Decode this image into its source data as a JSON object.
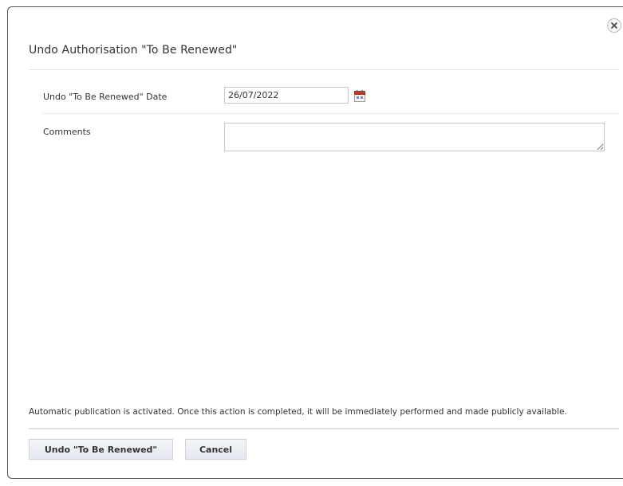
{
  "dialog": {
    "title": "Undo Authorisation \"To Be Renewed\"",
    "close_icon": "close-icon"
  },
  "form": {
    "date_label": "Undo \"To Be Renewed\" Date",
    "date_value": "26/07/2022",
    "calendar_icon": "calendar-icon",
    "comments_label": "Comments",
    "comments_value": ""
  },
  "footer": {
    "notice": "Automatic publication is activated. Once this action is completed, it will be immediately performed and made publicly available.",
    "primary_label": "Undo \"To Be Renewed\"",
    "cancel_label": "Cancel"
  },
  "colors": {
    "border": "#555555",
    "calendar_accent": "#c0392b",
    "button_bg": "#e9edf3"
  }
}
